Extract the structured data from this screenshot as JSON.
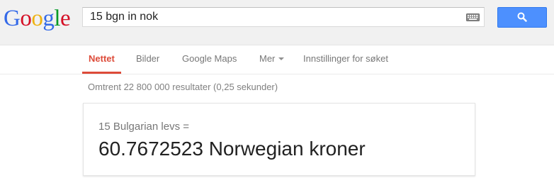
{
  "logo": {
    "letters": [
      "G",
      "o",
      "o",
      "g",
      "l",
      "e"
    ],
    "colors": [
      "#3369e8",
      "#d50f25",
      "#eeb211",
      "#3369e8",
      "#009925",
      "#d50f25"
    ]
  },
  "search": {
    "value": "15 bgn in nok",
    "keyboard_icon": "keyboard-icon",
    "button_icon": "search-icon",
    "button_color": "#4d90fe"
  },
  "nav": {
    "items": [
      {
        "label": "Nettet",
        "active": true
      },
      {
        "label": "Bilder",
        "active": false
      },
      {
        "label": "Google Maps",
        "active": false
      },
      {
        "label": "Mer",
        "active": false,
        "has_dropdown": true
      },
      {
        "label": "Innstillinger for søket",
        "active": false
      }
    ],
    "active_color": "#dd4b39"
  },
  "results": {
    "stats": "Omtrent 22 800 000 resultater (0,25 sekunder)"
  },
  "converter": {
    "query": "15 Bulgarian levs =",
    "result": "60.7672523 Norwegian kroner"
  }
}
